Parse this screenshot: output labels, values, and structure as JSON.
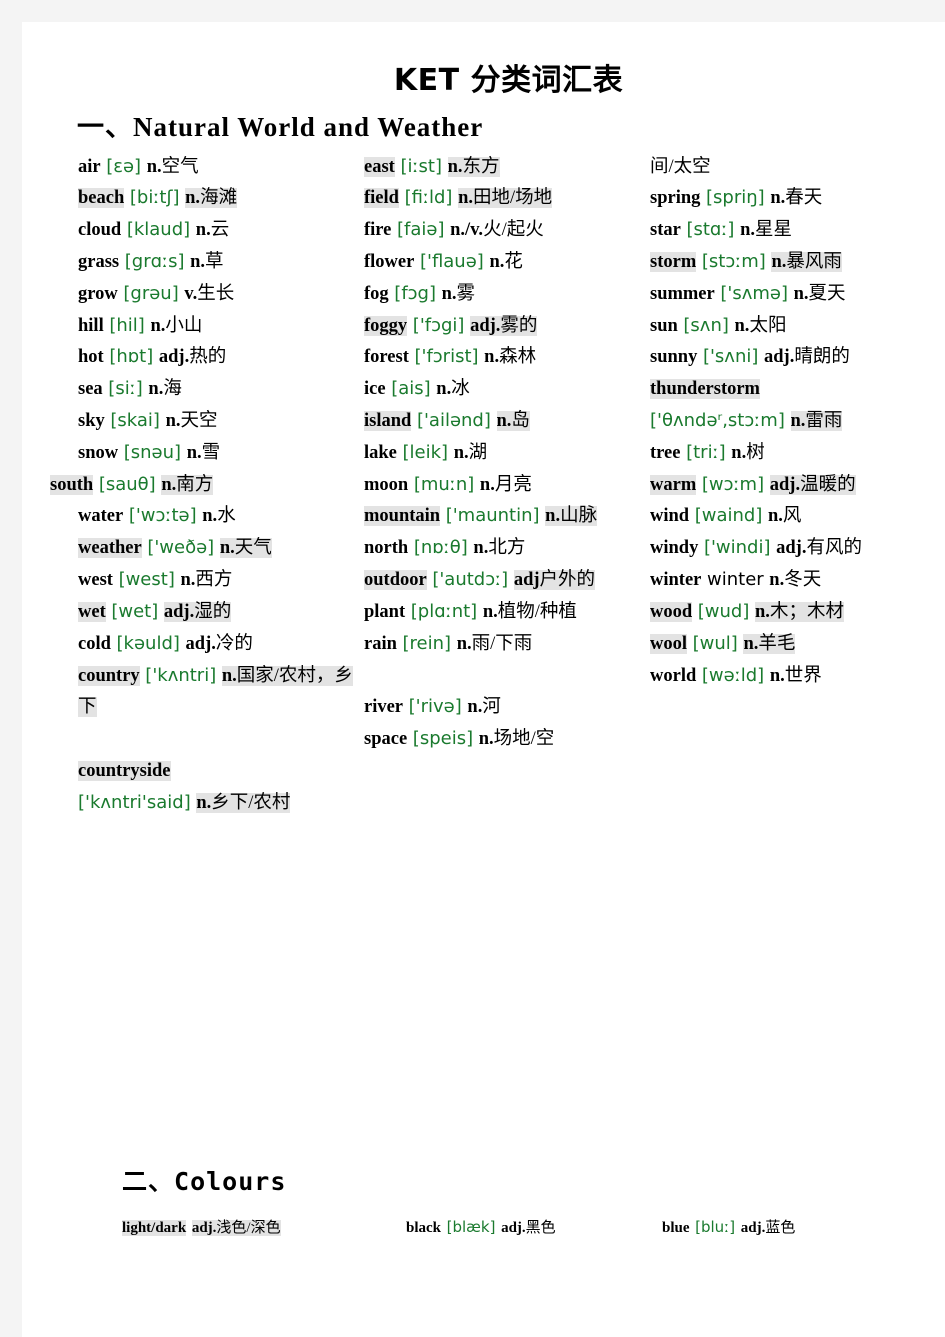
{
  "document": {
    "title": "KET 分类词汇表",
    "sections": [
      {
        "number": "一、",
        "name": "Natural World and Weather"
      },
      {
        "number": "二、",
        "name": "Colours"
      }
    ]
  },
  "natural_world": {
    "column1": [
      {
        "word": "air",
        "phonetic": "[ɛə]",
        "gloss": "n.空气",
        "hl_word": false,
        "hl_gloss": false
      },
      {
        "word": "beach",
        "phonetic": "[biːtʃ]",
        "gloss": "n. 海滩",
        "hl_word": true,
        "hl_gloss": true
      },
      {
        "word": "cloud",
        "phonetic": "[klaud]",
        "gloss": "n.云",
        "hl_word": false,
        "hl_gloss": false
      },
      {
        "word": "grass",
        "phonetic": "[grɑːs]",
        "gloss": "n.草",
        "hl_word": false,
        "hl_gloss": false
      },
      {
        "word": "grow",
        "phonetic": "[grəu]",
        "gloss": "v.生长",
        "hl_word": false,
        "hl_gloss": false
      },
      {
        "word": "hill",
        "phonetic": "[hil]",
        "gloss": "n.小山",
        "hl_word": false,
        "hl_gloss": false
      },
      {
        "word": "hot",
        "phonetic": "[hɒt]",
        "gloss": "adj.热的",
        "hl_word": false,
        "hl_gloss": false
      },
      {
        "word": "sea",
        "phonetic": "[siː]",
        "gloss": "n.海",
        "hl_word": false,
        "hl_gloss": false
      },
      {
        "word": "sky",
        "phonetic": "[skai]",
        "gloss": "n.天空",
        "hl_word": false,
        "hl_gloss": false
      },
      {
        "word": "snow",
        "phonetic": "[snəu]",
        "gloss": "n.雪",
        "hl_word": false,
        "hl_gloss": false
      },
      {
        "word": "south",
        "phonetic": "[sauθ]",
        "gloss": "n.南方",
        "hl_word": true,
        "hl_gloss": true,
        "outdent": true
      },
      {
        "word": "water",
        "phonetic": "['wɔːtə]",
        "gloss": "n.水",
        "hl_word": false,
        "hl_gloss": false
      },
      {
        "word": "weather",
        "phonetic": "['weðə]",
        "gloss": "n.天气",
        "hl_word": true,
        "hl_gloss": true
      },
      {
        "word": "west",
        "phonetic": "[west]",
        "gloss": "n.西方",
        "hl_word": false,
        "hl_gloss": false
      },
      {
        "word": "wet",
        "phonetic": "[wet]",
        "gloss": "adj.湿的",
        "hl_word": true,
        "hl_gloss": true
      },
      {
        "word": "cold",
        "phonetic": "[kəuld]",
        "gloss": "adj.冷的",
        "hl_word": false,
        "hl_gloss": false
      },
      {
        "word": "country",
        "phonetic": "['kʌntri]",
        "gloss": "n.国家/农村，乡下",
        "hl_word": true,
        "hl_gloss": true
      },
      {
        "word": "countryside",
        "phonetic": "['kʌntri'said]",
        "gloss": "n.乡下/农村",
        "hl_word": true,
        "hl_gloss": true,
        "spacer_before": true,
        "word_own_line": true
      }
    ],
    "column2": [
      {
        "word": "east",
        "phonetic": "[iːst]",
        "gloss": "n.东方",
        "hl_word": true,
        "hl_gloss": true
      },
      {
        "word": "field",
        "phonetic": "[fiːld]",
        "gloss": "n.田地/场地",
        "hl_word": true,
        "hl_gloss": true
      },
      {
        "word": "fire",
        "phonetic": "[faiə]",
        "gloss": "n./v.火/起火",
        "hl_word": false,
        "hl_gloss": false
      },
      {
        "word": "flower",
        "phonetic": "['flauə]",
        "gloss": "n.花",
        "hl_word": false,
        "hl_gloss": false
      },
      {
        "word": "fog",
        "phonetic": "[fɔg]",
        "gloss": "n.雾",
        "hl_word": false,
        "hl_gloss": false
      },
      {
        "word": "foggy",
        "phonetic": "['fɔgi]",
        "gloss": "adj.雾的",
        "hl_word": true,
        "hl_gloss": true
      },
      {
        "word": "forest",
        "phonetic": "['fɔrist]",
        "gloss": "n.森林",
        "hl_word": false,
        "hl_gloss": false
      },
      {
        "word": "ice",
        "phonetic": "[ais]",
        "gloss": "n.冰",
        "hl_word": false,
        "hl_gloss": false
      },
      {
        "word": "island",
        "phonetic": "['ailənd]",
        "gloss": "n.岛",
        "hl_word": true,
        "hl_gloss": true
      },
      {
        "word": "lake",
        "phonetic": "[leik]",
        "gloss": "n.湖",
        "hl_word": false,
        "hl_gloss": false
      },
      {
        "word": "moon",
        "phonetic": "[muːn]",
        "gloss": "n.月亮",
        "hl_word": false,
        "hl_gloss": false
      },
      {
        "word": "mountain",
        "phonetic": "['mauntin]",
        "gloss": "n.山脉",
        "hl_word": true,
        "hl_gloss": true
      },
      {
        "word": "north",
        "phonetic": "[nɒːθ]",
        "gloss": "n.北方",
        "hl_word": false,
        "hl_gloss": false
      },
      {
        "word": "outdoor",
        "phonetic": "['autdɔː]",
        "gloss": "adj 户外的",
        "hl_word": true,
        "hl_gloss": true
      },
      {
        "word": "plant",
        "phonetic": "[plɑːnt]",
        "gloss": "n.植物/种植",
        "hl_word": false,
        "hl_gloss": false
      },
      {
        "word": "rain",
        "phonetic": "[rein]",
        "gloss": "n.雨/下雨",
        "hl_word": false,
        "hl_gloss": false
      },
      {
        "word": "river",
        "phonetic": "['rivə]",
        "gloss": "n.河",
        "hl_word": false,
        "hl_gloss": false,
        "spacer_before": true
      },
      {
        "word": "space",
        "phonetic": "[speis]",
        "gloss": "n.场地/空",
        "hl_word": false,
        "hl_gloss": false
      }
    ],
    "column3": [
      {
        "word": "",
        "phonetic": "",
        "gloss": "间/太空",
        "hl_word": false,
        "hl_gloss": false,
        "continuation": true
      },
      {
        "word": "spring",
        "phonetic": "[spriŋ]",
        "gloss": "n.春天",
        "hl_word": false,
        "hl_gloss": false
      },
      {
        "word": "star",
        "phonetic": "[stɑː]",
        "gloss": "n.星星",
        "hl_word": false,
        "hl_gloss": false
      },
      {
        "word": "storm",
        "phonetic": "[stɔːm]",
        "gloss": "n.暴风雨",
        "hl_word": true,
        "hl_gloss": true
      },
      {
        "word": "summer",
        "phonetic": "['sʌmə]",
        "gloss": "n.夏天",
        "hl_word": false,
        "hl_gloss": false
      },
      {
        "word": "sun",
        "phonetic": "[sʌn]",
        "gloss": "n.太阳",
        "hl_word": false,
        "hl_gloss": false
      },
      {
        "word": "sunny",
        "phonetic": "['sʌni]",
        "gloss": "adj.晴朗的",
        "hl_word": false,
        "hl_gloss": false
      },
      {
        "word": "thunderstorm",
        "phonetic": "['θʌndəʳ,stɔːm]",
        "gloss": "n.雷雨",
        "hl_word": true,
        "hl_gloss": true,
        "word_own_line": true
      },
      {
        "word": "tree",
        "phonetic": "[triː]",
        "gloss": "n.树",
        "hl_word": false,
        "hl_gloss": false
      },
      {
        "word": "warm",
        "phonetic": "[wɔːm]",
        "gloss": "adj.温暖的",
        "hl_word": true,
        "hl_gloss": true
      },
      {
        "word": "wind",
        "phonetic": "[waind]",
        "gloss": "n.风",
        "hl_word": false,
        "hl_gloss": false
      },
      {
        "word": "windy",
        "phonetic": "['windi]",
        "gloss": "adj.有风的",
        "hl_word": false,
        "hl_gloss": false
      },
      {
        "word": "winter",
        "phonetic": "winter",
        "gloss": "n.冬天",
        "hl_word": false,
        "hl_gloss": false,
        "phonetic_plain": true
      },
      {
        "word": "wood",
        "phonetic": "[wud]",
        "gloss": "n.木；木材",
        "hl_word": true,
        "hl_gloss": true
      },
      {
        "word": "wool",
        "phonetic": "[wul]",
        "gloss": "n.羊毛",
        "hl_word": true,
        "hl_gloss": true
      },
      {
        "word": "world",
        "phonetic": "[wəːld]",
        "gloss": "n.世界",
        "hl_word": false,
        "hl_gloss": false
      }
    ]
  },
  "colours": {
    "column1": [
      {
        "word": "light/dark",
        "phonetic": "",
        "gloss": "adj. 浅色/深色",
        "hl_word": true,
        "hl_gloss": true
      }
    ],
    "column2": [
      {
        "word": "black",
        "phonetic": "[blæk]",
        "gloss": "adj. 黑色",
        "hl_word": false,
        "hl_gloss": false
      }
    ],
    "column3": [
      {
        "word": "blue",
        "phonetic": "[bluː]",
        "gloss": "adj. 蓝色",
        "hl_word": false,
        "hl_gloss": false
      }
    ]
  },
  "colors": {
    "page_background": "#ffffff",
    "margin_background": "#f4f4f4",
    "text": "#000000",
    "phonetic_green": "#1a7a2e",
    "highlight": "#e3e3e3"
  }
}
